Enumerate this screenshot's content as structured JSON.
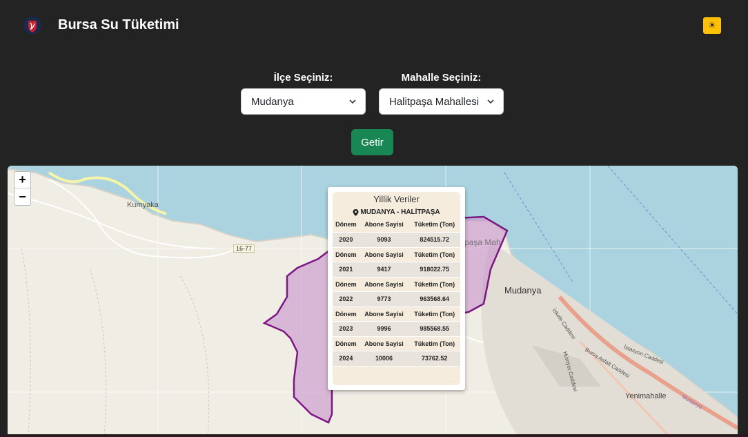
{
  "header": {
    "logo_icon": "red-shield-logo-icon",
    "title": "Bursa Su Tüketimi",
    "theme_toggle_icon": "sun-icon",
    "theme_toggle_glyph": "☀"
  },
  "filters": {
    "district_label": "İlçe Seçiniz:",
    "district_value": "Mudanya",
    "neighborhood_label": "Mahalle Seçiniz:",
    "neighborhood_value": "Halitpaşa Mahallesi",
    "submit_label": "Getir"
  },
  "map": {
    "zoom_in": "+",
    "zoom_out": "−",
    "labels": {
      "kumyaka": "Kumyaka",
      "mudanya": "Mudanya",
      "yenimahalle": "Yenimahalle",
      "road_code": "16-77",
      "halitpasa_partial": "paşa Mah",
      "iskele_caddesi": "İskele Caddesi",
      "bursa_caddesi": "Bursa Asfalt Caddesi",
      "istasyon_caddesi": "İstasyon Caddesi",
      "hurriyet_caddesi": "Hürriyet Caddesi",
      "mudanya_small": "Mudanya"
    },
    "colors": {
      "water": "#aad3df",
      "land": "#f0ede5",
      "polygon_fill": "#c589c8",
      "polygon_stroke": "#7b1683",
      "main_road": "#e8a28c"
    }
  },
  "popup": {
    "title": "Yillik Veriler",
    "location_icon": "map-pin-icon",
    "location": "MUDANYA - HALİTPAŞA",
    "columns": [
      "Dönem",
      "Abone Sayisi",
      "Tüketim (Ton)"
    ],
    "rows": [
      {
        "donem": "2020",
        "abone": "9093",
        "tuketim": "824515.72"
      },
      {
        "donem": "2021",
        "abone": "9417",
        "tuketim": "918022.75"
      },
      {
        "donem": "2022",
        "abone": "9773",
        "tuketim": "963568.64"
      },
      {
        "donem": "2023",
        "abone": "9996",
        "tuketim": "985568.55"
      },
      {
        "donem": "2024",
        "abone": "10006",
        "tuketim": "73762.52"
      }
    ]
  }
}
